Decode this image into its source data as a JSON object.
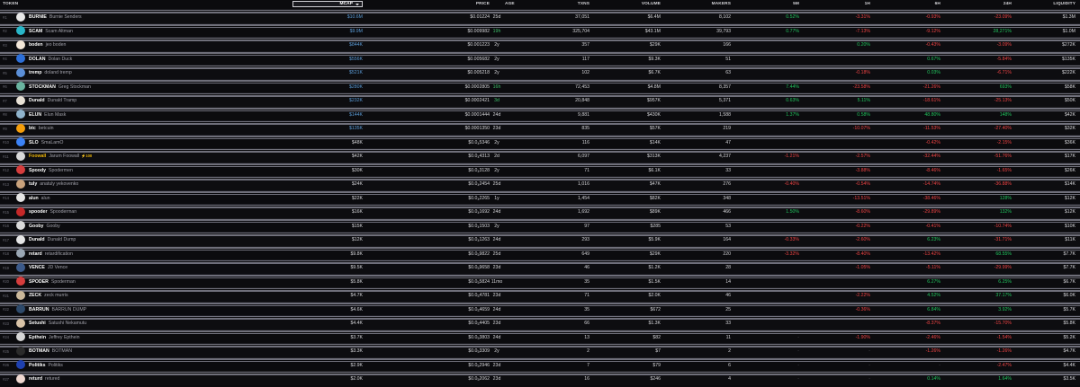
{
  "header": {
    "token": "TOKEN",
    "mcap": "MCAP",
    "price": "PRICE",
    "age": "AGE",
    "txns": "TXNS",
    "volume": "VOLUME",
    "makers": "MAKERS",
    "m5": "5M",
    "h1": "1H",
    "h6": "6H",
    "h24": "24H",
    "liquidity": "LIQUIDITY"
  },
  "colors": {
    "up": "#22c55e",
    "down": "#ef4444",
    "mcap_link": "#5b9bd5"
  },
  "rows": [
    {
      "rank": "#1",
      "sym": "BURNIE",
      "name": "Burnie Senders",
      "mcap": "$10.6M",
      "mcap_hl": true,
      "price": "$0.01224",
      "age": "25d",
      "txns": "37,051",
      "vol": "$6.4M",
      "makers": "8,102",
      "m5": "0.52%",
      "h1": "-3.31%",
      "h6": "-0.93%",
      "h24": "-23.09%",
      "liq": "$1.3M",
      "avc": "#e8e8e8",
      "m5c": "g",
      "h1c": "rd",
      "h6c": "rd",
      "h24c": "rd"
    },
    {
      "rank": "#2",
      "sym": "SCAM",
      "name": "Scam Altman",
      "mcap": "$9.9M",
      "mcap_hl": true,
      "price": "$0.009982",
      "age": "19h",
      "age_new": true,
      "txns": "325,704",
      "vol": "$43.1M",
      "makers": "39,793",
      "m5": "0.77%",
      "h1": "-7.13%",
      "h6": "-9.12%",
      "h24": "28,271%",
      "liq": "$1.0M",
      "avc": "#29b6c8",
      "m5c": "g",
      "h1c": "rd",
      "h6c": "rd",
      "h24c": "g"
    },
    {
      "rank": "#3",
      "sym": "boden",
      "name": "jeo boden",
      "mcap": "$844K",
      "mcap_hl": true,
      "price": "$0.001223",
      "age": "2y",
      "txns": "357",
      "vol": "$29K",
      "makers": "166",
      "m5": "",
      "h1": "0.20%",
      "h6": "-0.43%",
      "h24": "-3.09%",
      "liq": "$272K",
      "avc": "#f3e7d8",
      "m5c": "",
      "h1c": "g",
      "h6c": "rd",
      "h24c": "rd"
    },
    {
      "rank": "#4",
      "sym": "DOLAN",
      "name": "Dolan Duck",
      "mcap": "$556K",
      "mcap_hl": true,
      "price": "$0.005682",
      "age": "2y",
      "txns": "117",
      "vol": "$9.3K",
      "makers": "51",
      "m5": "",
      "h1": "",
      "h6": "0.67%",
      "h24": "-5.84%",
      "liq": "$135K",
      "avc": "#2d6fd8",
      "m5c": "",
      "h1c": "",
      "h6c": "g",
      "h24c": "rd"
    },
    {
      "rank": "#5",
      "sym": "tremp",
      "name": "doland tremp",
      "mcap": "$521K",
      "mcap_hl": true,
      "price": "$0.005218",
      "age": "2y",
      "txns": "102",
      "vol": "$6.7K",
      "makers": "63",
      "m5": "",
      "h1": "-0.18%",
      "h6": "0.03%",
      "h24": "-6.71%",
      "liq": "$222K",
      "avc": "#5b8fd8",
      "m5c": "",
      "h1c": "rd",
      "h6c": "g",
      "h24c": "rd"
    },
    {
      "rank": "#6",
      "sym": "STOCKMAN",
      "name": "Greg Stockman",
      "mcap": "$280K",
      "mcap_hl": true,
      "price": "$0.0002805",
      "age": "16h",
      "age_new": true,
      "txns": "72,453",
      "vol": "$4.8M",
      "makers": "8,357",
      "m5": "7.44%",
      "h1": "-23.58%",
      "h6": "-21.26%",
      "h24": "693%",
      "liq": "$58K",
      "avc": "#6ab4a0",
      "m5c": "g",
      "h1c": "rd",
      "h6c": "rd",
      "h24c": "g"
    },
    {
      "rank": "#7",
      "sym": "Dunald",
      "name": "Dunald Tramp",
      "mcap": "$232K",
      "mcap_hl": true,
      "price": "$0.0002421",
      "age": "3d",
      "age_new": true,
      "txns": "20,848",
      "vol": "$957K",
      "makers": "5,371",
      "m5": "0.63%",
      "h1": "5.11%",
      "h6": "-18.61%",
      "h24": "-25.13%",
      "liq": "$50K",
      "avc": "#e9e2d6",
      "m5c": "g",
      "h1c": "g",
      "h6c": "rd",
      "h24c": "rd"
    },
    {
      "rank": "#8",
      "sym": "ELUN",
      "name": "Elun Mask",
      "mcap": "$144K",
      "mcap_hl": true,
      "price": "$0.0001444",
      "age": "24d",
      "txns": "9,881",
      "vol": "$430K",
      "makers": "1,588",
      "m5": "1.37%",
      "h1": "0.58%",
      "h6": "48.80%",
      "h24": "148%",
      "liq": "$42K",
      "avc": "#8fb3cc",
      "m5c": "g",
      "h1c": "g",
      "h6c": "g",
      "h24c": "g"
    },
    {
      "rank": "#9",
      "sym": "btc",
      "name": "betcuin",
      "mcap": "$135K",
      "mcap_hl": true,
      "price": "$0.0001350",
      "age": "23d",
      "txns": "835",
      "vol": "$57K",
      "makers": "219",
      "m5": "",
      "h1": "-10.07%",
      "h6": "-11.53%",
      "h24": "-27.40%",
      "liq": "$32K",
      "avc": "#f59e0b",
      "m5c": "",
      "h1c": "rd",
      "h6c": "rd",
      "h24c": "rd"
    },
    {
      "rank": "#10",
      "sym": "SLO",
      "name": "SmaLamO",
      "mcap": "$48K",
      "mcap_hl": false,
      "price": "$0.0",
      "price_sub": "4",
      "price_tail": "5346",
      "age": "2y",
      "txns": "116",
      "vol": "$14K",
      "makers": "47",
      "m5": "",
      "h1": "",
      "h6": "-0.42%",
      "h24": "-2.15%",
      "liq": "$36K",
      "avc": "#3b82f6",
      "m5c": "",
      "h1c": "",
      "h6c": "rd",
      "h24c": "rd"
    },
    {
      "rank": "#11",
      "sym": "Foowall",
      "name": "Jarum Foowall",
      "boost": "⚡100",
      "gold": true,
      "mcap": "$42K",
      "mcap_hl": false,
      "price": "$0.0",
      "price_sub": "4",
      "price_tail": "4313",
      "age": "2d",
      "txns": "6,097",
      "vol": "$313K",
      "makers": "4,237",
      "m5": "-1.21%",
      "h1": "-2.57%",
      "h6": "-32.44%",
      "h24": "-51.76%",
      "liq": "$17K",
      "avc": "#d9d9d9",
      "m5c": "rd",
      "h1c": "rd",
      "h6c": "rd",
      "h24c": "rd"
    },
    {
      "rank": "#12",
      "sym": "Spoody",
      "name": "Spodermen",
      "mcap": "$30K",
      "mcap_hl": false,
      "price": "$0.0",
      "price_sub": "4",
      "price_tail": "3128",
      "age": "2y",
      "txns": "71",
      "vol": "$6.1K",
      "makers": "33",
      "m5": "",
      "h1": "-3.88%",
      "h6": "-8.46%",
      "h24": "-1.65%",
      "liq": "$26K",
      "avc": "#d63d3d",
      "m5c": "",
      "h1c": "rd",
      "h6c": "rd",
      "h24c": "rd"
    },
    {
      "rank": "#13",
      "sym": "tuly",
      "name": "anatuly yekovenko",
      "mcap": "$24K",
      "mcap_hl": false,
      "price": "$0.0",
      "price_sub": "4",
      "price_tail": "2454",
      "age": "25d",
      "txns": "1,016",
      "vol": "$47K",
      "makers": "276",
      "m5": "-0.40%",
      "h1": "-0.54%",
      "h6": "-14.74%",
      "h24": "-36.88%",
      "liq": "$14K",
      "avc": "#c9a27c",
      "m5c": "rd",
      "h1c": "rd",
      "h6c": "rd",
      "h24c": "rd"
    },
    {
      "rank": "#14",
      "sym": "alun",
      "name": "alun",
      "mcap": "$22K",
      "mcap_hl": false,
      "price": "$0.0",
      "price_sub": "4",
      "price_tail": "2265",
      "age": "1y",
      "txns": "1,454",
      "vol": "$82K",
      "makers": "348",
      "m5": "",
      "h1": "-13.51%",
      "h6": "-38.46%",
      "h24": "128%",
      "liq": "$12K",
      "avc": "#e5e5e5",
      "m5c": "",
      "h1c": "rd",
      "h6c": "rd",
      "h24c": "g"
    },
    {
      "rank": "#15",
      "sym": "spooder",
      "name": "Spooderman",
      "mcap": "$16K",
      "mcap_hl": false,
      "price": "$0.0",
      "price_sub": "4",
      "price_tail": "1692",
      "age": "24d",
      "txns": "1,692",
      "vol": "$89K",
      "makers": "466",
      "m5": "1.50%",
      "h1": "-8.60%",
      "h6": "-29.89%",
      "h24": "132%",
      "liq": "$12K",
      "avc": "#c62828",
      "m5c": "g",
      "h1c": "rd",
      "h6c": "rd",
      "h24c": "g"
    },
    {
      "rank": "#16",
      "sym": "Gooby",
      "name": "Gooby",
      "mcap": "$15K",
      "mcap_hl": false,
      "price": "$0.0",
      "price_sub": "4",
      "price_tail": "1503",
      "age": "2y",
      "txns": "97",
      "vol": "$285",
      "makers": "53",
      "m5": "",
      "h1": "-0.22%",
      "h6": "-0.41%",
      "h24": "-10.74%",
      "liq": "$10K",
      "avc": "#d9d9d9",
      "m5c": "",
      "h1c": "rd",
      "h6c": "rd",
      "h24c": "rd"
    },
    {
      "rank": "#17",
      "sym": "Dunald",
      "name": "Dunald Dump",
      "mcap": "$12K",
      "mcap_hl": false,
      "price": "$0.0",
      "price_sub": "4",
      "price_tail": "1263",
      "age": "24d",
      "txns": "293",
      "vol": "$5.9K",
      "makers": "164",
      "m5": "-0.33%",
      "h1": "-2.60%",
      "h6": "6.23%",
      "h24": "-31.71%",
      "liq": "$11K",
      "avc": "#e6e6e6",
      "m5c": "rd",
      "h1c": "rd",
      "h6c": "g",
      "h24c": "rd"
    },
    {
      "rank": "#18",
      "sym": "retard",
      "name": "retardification",
      "mcap": "$9.8K",
      "mcap_hl": false,
      "price": "$0.0",
      "price_sub": "5",
      "price_tail": "9822",
      "age": "25d",
      "txns": "649",
      "vol": "$29K",
      "makers": "220",
      "m5": "-3.32%",
      "h1": "-8.40%",
      "h6": "-13.42%",
      "h24": "68.55%",
      "liq": "$7.7K",
      "avc": "#9aa7b4",
      "m5c": "rd",
      "h1c": "rd",
      "h6c": "rd",
      "h24c": "g"
    },
    {
      "rank": "#19",
      "sym": "VENCE",
      "name": "JD Vence",
      "mcap": "$9.5K",
      "mcap_hl": false,
      "price": "$0.0",
      "price_sub": "5",
      "price_tail": "9658",
      "age": "23d",
      "txns": "46",
      "vol": "$1.2K",
      "makers": "28",
      "m5": "",
      "h1": "-1.05%",
      "h6": "-5.11%",
      "h24": "-29.99%",
      "liq": "$7.7K",
      "avc": "#3c5a8a",
      "m5c": "",
      "h1c": "rd",
      "h6c": "rd",
      "h24c": "rd"
    },
    {
      "rank": "#20",
      "sym": "SPODER",
      "name": "Spoderman",
      "mcap": "$5.8K",
      "mcap_hl": false,
      "price": "$0.0",
      "price_sub": "5",
      "price_tail": "5824",
      "age": "11mo",
      "txns": "35",
      "vol": "$1.5K",
      "makers": "14",
      "m5": "",
      "h1": "",
      "h6": "6.27%",
      "h24": "6.25%",
      "liq": "$6.7K",
      "avc": "#d63d3d",
      "m5c": "",
      "h1c": "",
      "h6c": "g",
      "h24c": "g"
    },
    {
      "rank": "#21",
      "sym": "ZECK",
      "name": "zeck murris",
      "mcap": "$4.7K",
      "mcap_hl": false,
      "price": "$0.0",
      "price_sub": "5",
      "price_tail": "4781",
      "age": "23d",
      "txns": "71",
      "vol": "$2.0K",
      "makers": "46",
      "m5": "",
      "h1": "-2.22%",
      "h6": "4.52%",
      "h24": "37.17%",
      "liq": "$6.0K",
      "avc": "#cbb89a",
      "m5c": "",
      "h1c": "rd",
      "h6c": "g",
      "h24c": "g"
    },
    {
      "rank": "#22",
      "sym": "BARRUN",
      "name": "BARRUN DUMP",
      "mcap": "$4.6K",
      "mcap_hl": false,
      "price": "$0.0",
      "price_sub": "5",
      "price_tail": "4659",
      "age": "24d",
      "txns": "35",
      "vol": "$672",
      "makers": "25",
      "m5": "",
      "h1": "-0.36%",
      "h6": "6.84%",
      "h24": "3.92%",
      "liq": "$5.7K",
      "avc": "#2e4a6b",
      "m5c": "",
      "h1c": "rd",
      "h6c": "g",
      "h24c": "g"
    },
    {
      "rank": "#23",
      "sym": "Setushi",
      "name": "Satushi Nekamutu",
      "mcap": "$4.4K",
      "mcap_hl": false,
      "price": "$0.0",
      "price_sub": "5",
      "price_tail": "4405",
      "age": "23d",
      "txns": "66",
      "vol": "$1.3K",
      "makers": "33",
      "m5": "",
      "h1": "",
      "h6": "-8.37%",
      "h24": "-15.70%",
      "liq": "$5.8K",
      "avc": "#d9c4a8",
      "m5c": "",
      "h1c": "",
      "h6c": "rd",
      "h24c": "rd"
    },
    {
      "rank": "#24",
      "sym": "Epthein",
      "name": "Jeffrey Epthein",
      "mcap": "$3.7K",
      "mcap_hl": false,
      "price": "$0.0",
      "price_sub": "5",
      "price_tail": "3803",
      "age": "24d",
      "txns": "13",
      "vol": "$82",
      "makers": "11",
      "m5": "-",
      "h1": "-1.90%",
      "h6": "-2.46%",
      "h24": "-1.54%",
      "liq": "$5.2K",
      "avc": "#d6d6d6",
      "m5c": "dim",
      "h1c": "rd",
      "h6c": "rd",
      "h24c": "rd"
    },
    {
      "rank": "#25",
      "sym": "BOTMAN",
      "name": "BOTMAN",
      "mcap": "$3.3K",
      "mcap_hl": false,
      "price": "$0.0",
      "price_sub": "5",
      "price_tail": "3309",
      "age": "2y",
      "txns": "2",
      "vol": "$7",
      "makers": "2",
      "m5": "-",
      "h1": "-",
      "h6": "-1.26%",
      "h24": "-1.26%",
      "liq": "$4.7K",
      "avc": "#2b2b2b",
      "m5c": "dim",
      "h1c": "dim",
      "h6c": "rd",
      "h24c": "rd"
    },
    {
      "rank": "#26",
      "sym": "Politiks",
      "name": "Politiks",
      "mcap": "$2.9K",
      "mcap_hl": false,
      "price": "$0.0",
      "price_sub": "5",
      "price_tail": "2946",
      "age": "23d",
      "txns": "7",
      "vol": "$79",
      "makers": "6",
      "m5": "-",
      "h1": "-",
      "h6": "-",
      "h24": "-2.47%",
      "liq": "$4.4K",
      "avc": "#1e40af",
      "m5c": "dim",
      "h1c": "dim",
      "h6c": "dim",
      "h24c": "rd"
    },
    {
      "rank": "#27",
      "sym": "returd",
      "name": "retured",
      "mcap": "$2.0K",
      "mcap_hl": false,
      "price": "$0.0",
      "price_sub": "5",
      "price_tail": "2062",
      "age": "23d",
      "txns": "16",
      "vol": "$246",
      "makers": "4",
      "m5": "-",
      "h1": "-",
      "h6": "0.14%",
      "h24": "1.64%",
      "liq": "$3.5K",
      "avc": "#f0d8d0",
      "m5c": "dim",
      "h1c": "dim",
      "h6c": "g",
      "h24c": "g"
    }
  ]
}
